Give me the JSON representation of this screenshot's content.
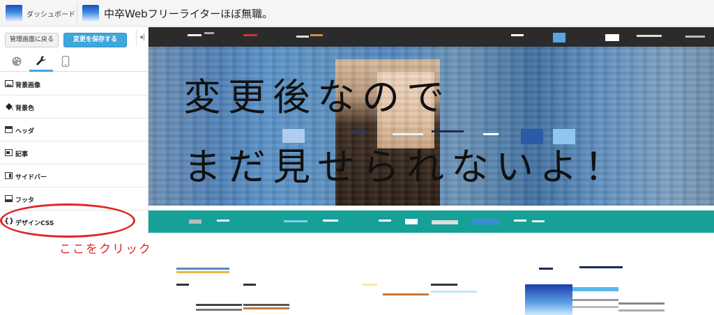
{
  "topbar": {
    "dashboard_label": "ダッシュボード",
    "blog_title": "中卒Webフリーライターほぼ無職。"
  },
  "sidebar": {
    "back_button": "管理画面に戻る",
    "save_button": "変更を保存する",
    "collapse_icon": "◂|",
    "tabs": [
      {
        "name": "palette",
        "glyph": "🎨"
      },
      {
        "name": "wrench",
        "glyph": "🔧"
      },
      {
        "name": "mobile",
        "glyph": "📱"
      }
    ],
    "items": [
      {
        "label": "背景画像",
        "icon": "image-icon"
      },
      {
        "label": "背景色",
        "icon": "paint-bucket-icon"
      },
      {
        "label": "ヘッダ",
        "icon": "header-layout-icon"
      },
      {
        "label": "記事",
        "icon": "article-layout-icon"
      },
      {
        "label": "サイドバー",
        "icon": "sidebar-layout-icon"
      },
      {
        "label": "フッタ",
        "icon": "footer-layout-icon"
      },
      {
        "label": "デザインCSS",
        "icon": "braces-icon",
        "glyph": "{}"
      }
    ]
  },
  "annotation": {
    "text": "ここをクリック！",
    "color": "#e02424"
  },
  "preview": {
    "overlay_line1": "変更後なので",
    "overlay_line2": "まだ見せられないよ！",
    "teal_color": "#17a097",
    "nav_color": "#2b2b2b"
  }
}
